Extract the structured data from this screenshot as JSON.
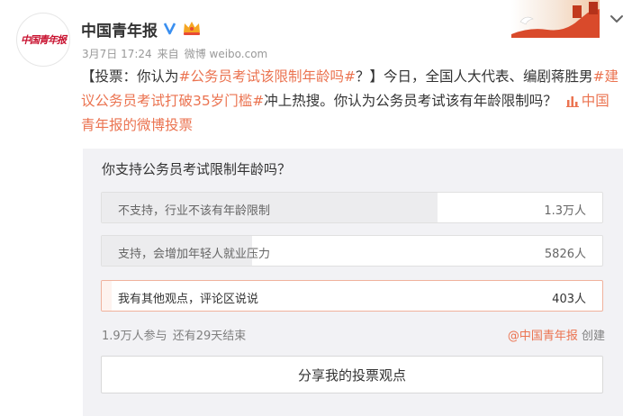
{
  "user": {
    "name": "中国青年报",
    "avatar_text": "中国青年报"
  },
  "meta": {
    "time": "3月7日 17:24",
    "source_prefix": "来自",
    "source": "微博 weibo.com"
  },
  "post": {
    "part1": "【投票：你认为",
    "tag1": "#公务员考试该限制年龄吗#",
    "part2": "？】今日，全国人大代表、编剧蒋胜男",
    "tag2": "#建议公务员考试打破35岁门槛#",
    "part3": "冲上热搜。你认为公务员考试该有年龄限制吗？",
    "vote_link": "中国青年报的微博投票"
  },
  "poll": {
    "question": "你支持公务员考试限制年龄吗？",
    "options": [
      {
        "label": "不支持，行业不该有年龄限制",
        "count": "1.3万人",
        "share": 0.67,
        "selected": false
      },
      {
        "label": "支持，会增加年轻人就业压力",
        "count": "5826人",
        "share": 0.3,
        "selected": false
      },
      {
        "label": "我有其他观点，评论区说说",
        "count": "403人",
        "share": 0.02,
        "selected": true
      }
    ],
    "participants": "1.9万人参与",
    "remaining": "还有29天结束",
    "creator_mention": "@中国青年报",
    "creator_suffix": "创建",
    "share_label": "分享我的投票观点"
  },
  "colors": {
    "accent": "#eb7350",
    "brand_red": "#c8102e",
    "poll_bg": "#f2f2f5"
  }
}
